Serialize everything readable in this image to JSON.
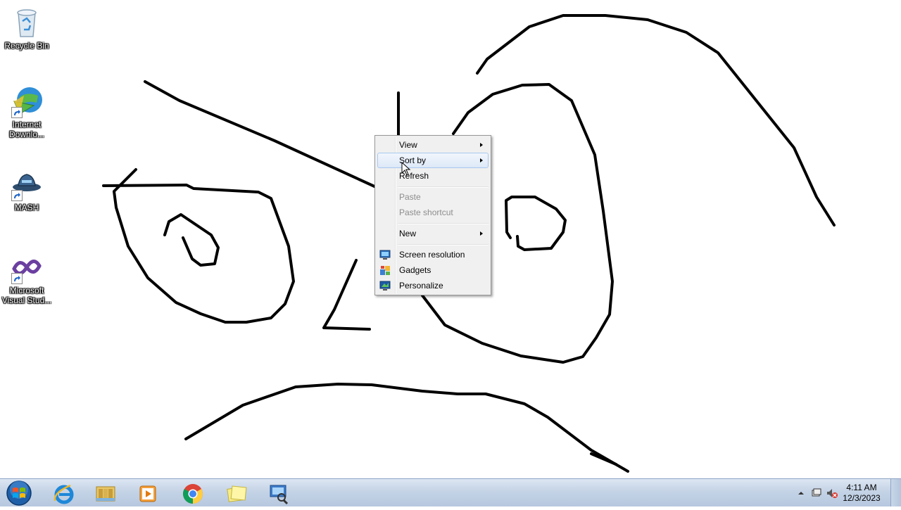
{
  "desktop": {
    "icons": [
      {
        "label": "Recycle Bin",
        "icon": "recycle-bin-icon"
      },
      {
        "label": "Internet\nDownlo...",
        "icon": "internet-download-manager-icon"
      },
      {
        "label": "MASH",
        "icon": "mash-icon"
      },
      {
        "label": "Microsoft\nVisual Stud...",
        "icon": "visual-studio-icon"
      }
    ]
  },
  "context_menu": {
    "view": "View",
    "sort_by": "Sort by",
    "refresh": "Refresh",
    "paste": "Paste",
    "paste_shortcut": "Paste shortcut",
    "new": "New",
    "screen_resolution": "Screen resolution",
    "gadgets": "Gadgets",
    "personalize": "Personalize"
  },
  "taskbar": {
    "pinned": [
      "start-orb",
      "internet-explorer-icon",
      "file-explorer-icon",
      "media-player-icon",
      "chrome-icon",
      "sticky-notes-icon",
      "search-tool-icon"
    ],
    "clock": {
      "time": "4:11 AM",
      "date": "12/3/2023"
    }
  },
  "colors": {
    "menu_highlight": "#dde9f8",
    "taskbar": "#c4d3e6"
  }
}
